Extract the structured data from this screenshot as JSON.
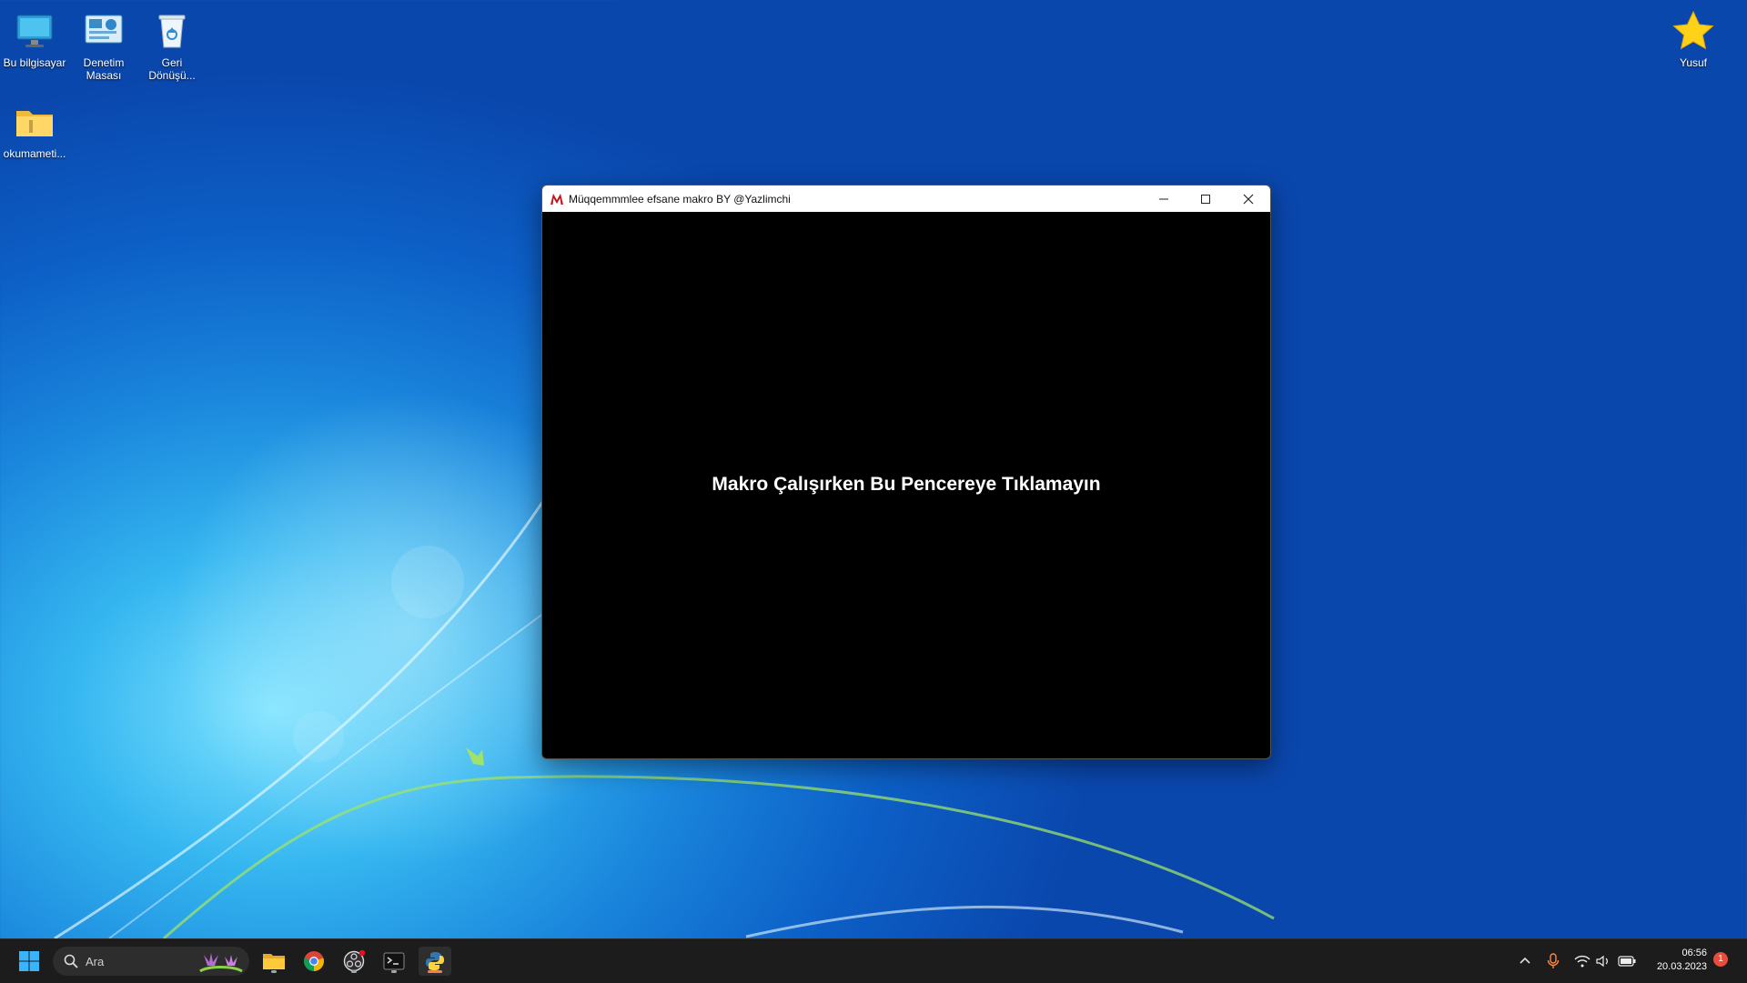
{
  "desktop": {
    "icons": [
      {
        "label": "Bu bilgisayar"
      },
      {
        "label": "Denetim Masası"
      },
      {
        "label": "Geri Dönüşü..."
      },
      {
        "label": "okumameti..."
      },
      {
        "label": "Yusuf"
      }
    ]
  },
  "window": {
    "title": "Müqqemmmlee efsane makro BY @Yazlimchi",
    "message": "Makro Çalışırken Bu Pencereye Tıklamayın",
    "controls": {
      "minimize": "minimize-icon",
      "maximize": "maximize-icon",
      "close": "close-icon"
    }
  },
  "taskbar": {
    "search_placeholder": "Ara",
    "apps": [
      "start-icon",
      "file-explorer-icon",
      "chrome-icon",
      "obs-icon",
      "terminal-icon",
      "python-icon"
    ],
    "clock": {
      "time": "06:56",
      "date": "20.03.2023"
    },
    "notification_count": "1"
  },
  "colors": {
    "accent": "#0a5fd0",
    "taskbar": "#1c1c1c",
    "window_bg": "#000000"
  }
}
